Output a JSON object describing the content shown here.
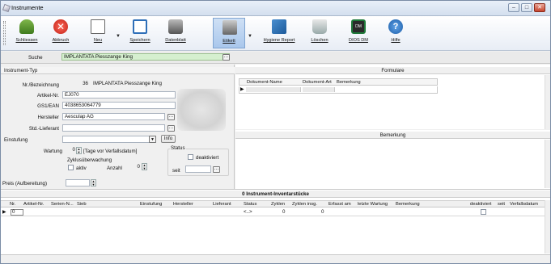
{
  "window": {
    "title": "Instrumente",
    "minimize": "–",
    "maximize": "□",
    "close": "✕"
  },
  "toolbar": {
    "buttons": [
      {
        "label": "Schliessen",
        "icon": "exit-icon"
      },
      {
        "label": "Abbruch",
        "icon": "cancel-icon"
      },
      {
        "label": "Neu",
        "icon": "new-document-icon"
      },
      {
        "label": "Speichern",
        "icon": "save-icon"
      },
      {
        "label": "Datenblatt",
        "icon": "datasheet-icon"
      },
      {
        "label": "Etikett",
        "icon": "label-printer-icon"
      },
      {
        "label": "Hygiene Report",
        "icon": "hygiene-report-icon"
      },
      {
        "label": "Löschen",
        "icon": "trash-icon"
      },
      {
        "label": "DIOS DM",
        "icon": "dios-dm-icon"
      },
      {
        "label": "Hilfe",
        "icon": "help-icon"
      }
    ],
    "dropdown_arrow": "▼"
  },
  "search": {
    "label": "Suche",
    "value": "IMPLANTATA Piesszange King",
    "button": "…"
  },
  "instrument_type": {
    "header": "Instrument-Typ"
  },
  "form": {
    "nr_label": "Nr./Bezeichnung",
    "nr_value": "36",
    "name_value": "IMPLANTATA Piesszange King",
    "artikel_label": "Artikel-Nr.",
    "artikel_value": "EJ070",
    "gs1_label": "GS1/EAN",
    "gs1_value": "4038653064779",
    "hersteller_label": "Hersteller",
    "hersteller_value": "Aesculap AG",
    "lieferant_label": "Std.-Lieferant",
    "lieferant_value": "",
    "einstufung_label": "Einstufung",
    "einstufung_value": "",
    "info_button": "Info",
    "wartung_label": "Wartung",
    "wartung_value": "0",
    "wartung_unit": "[Tage vor Verfallsdatum]",
    "zyklus_label": "Zyklusüberwachung",
    "zyklus_aktiv_label": "aktiv",
    "anzahl_label": "Anzahl",
    "anzahl_value": "0",
    "status_label": "Status",
    "deaktiviert_label": "deaktiviert",
    "seit_label": "seit",
    "seit_value": "",
    "preis_label": "Preis (Aufbereitung)",
    "preis_value": ""
  },
  "formulare": {
    "header": "Formulare",
    "columns": [
      "Dokument-Name",
      "Dokument-Art",
      "Bemerkung"
    ]
  },
  "bemerkung": {
    "header": "Bemerkung"
  },
  "inventory": {
    "header": "0 Instrument-Inventarstücke",
    "columns": [
      "Nr.",
      "Artikel-Nr.",
      "Serien-N...",
      "Sieb",
      "Einstufung",
      "Hersteller",
      "Lieferant",
      "Status",
      "Zyklen",
      "Zyklen insg.",
      "Erfasst am",
      "letzte Wartung",
      "Bemerkung",
      "deaktiviert",
      "seit",
      "Verfallsdatum"
    ],
    "row": {
      "nr": "0",
      "status": "<..>",
      "zyklen": "0",
      "zyklen_insg": "0"
    }
  }
}
